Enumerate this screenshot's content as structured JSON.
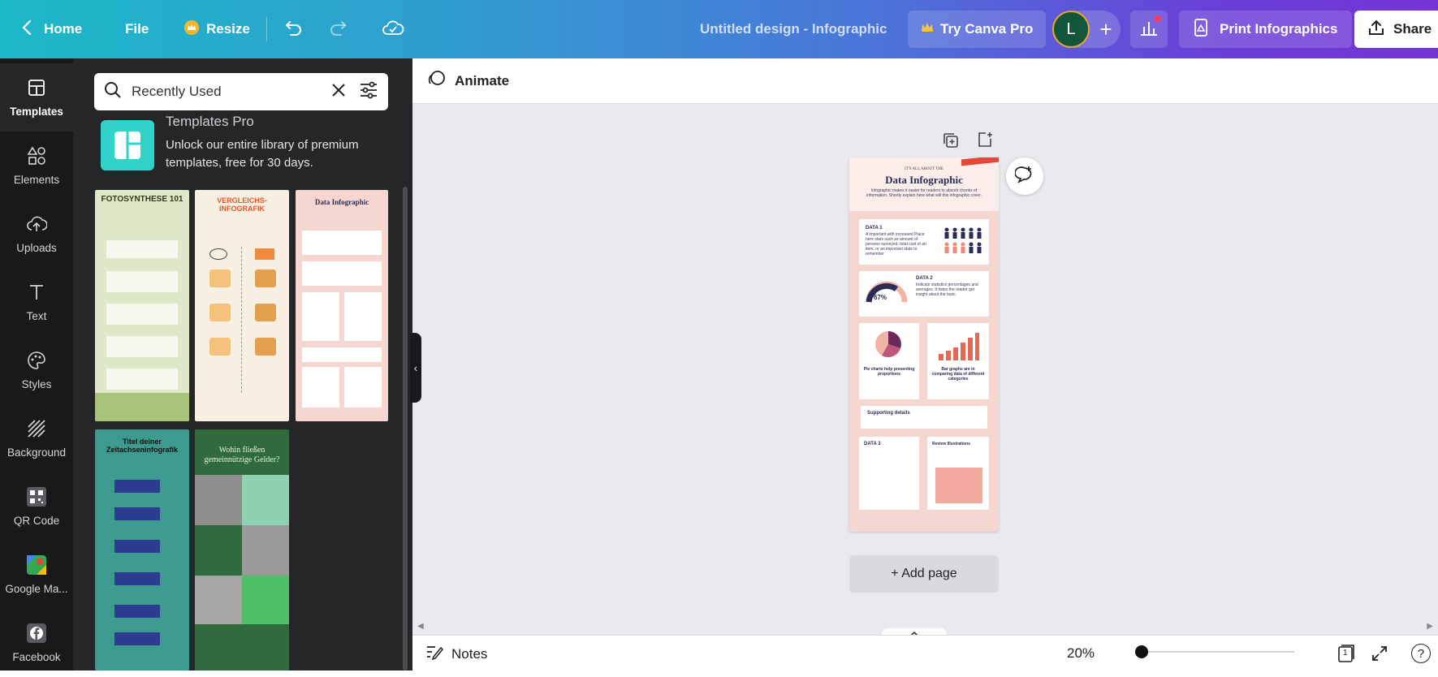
{
  "topbar": {
    "home": "Home",
    "file": "File",
    "resize": "Resize",
    "design_title": "Untitled design - Infographic",
    "try_pro": "Try Canva Pro",
    "avatar_letter": "L",
    "print": "Print Infographics",
    "share": "Share"
  },
  "rail": {
    "items": [
      {
        "label": "Templates"
      },
      {
        "label": "Elements"
      },
      {
        "label": "Uploads"
      },
      {
        "label": "Text"
      },
      {
        "label": "Styles"
      },
      {
        "label": "Background"
      },
      {
        "label": "QR Code"
      },
      {
        "label": "Google Ma..."
      },
      {
        "label": "Facebook"
      }
    ]
  },
  "panel": {
    "search_value": "Recently Used",
    "promo_title": "Templates Pro",
    "promo_desc": "Unlock our entire library of premium templates, free for 30 days.",
    "thumbs": [
      {
        "title": "FOTOSYNTHESE 101"
      },
      {
        "title": "VERGLEICHS-INFOGRAFIK"
      },
      {
        "title": "Data Infographic"
      },
      {
        "title": "Titel deiner Zeitachseninfografik"
      },
      {
        "title": "Wohin fließen gemeinnützige Gelder?"
      }
    ]
  },
  "canvas": {
    "animate": "Animate",
    "add_page": "+ Add page",
    "notes": "Notes",
    "zoom": "20%",
    "page_number": "1",
    "infographic": {
      "kicker": "IT'S ALL ABOUT THE",
      "title": "Data Infographic",
      "intro": "Infographic makes it easier for readers to absorb chunks of information. Shortly explain here what will this infographic cover.",
      "data1": "DATA 1",
      "data1_text": "A important with increased Place here stats such as amount of persons surveyed, total cost of an item, or an important stats to remember",
      "data2": "DATA 2",
      "data2_text": "Indicate statistics percentages and averages. It helps the reader get insight about the topic.",
      "percent": "67%",
      "pie_caption": "Pie charts help presenting proportions",
      "bar_caption": "Bar graphs are in comparing data of different categories",
      "supporting": "Supporting details",
      "data3": "DATA 3",
      "review": "Review Illustrations"
    }
  },
  "colors": {
    "accent_gradient_start": "#1db8c7",
    "accent_gradient_end": "#7535d6",
    "rail_bg": "#18191b",
    "panel_bg": "#252627",
    "canvas_bg": "#e9eaee"
  }
}
